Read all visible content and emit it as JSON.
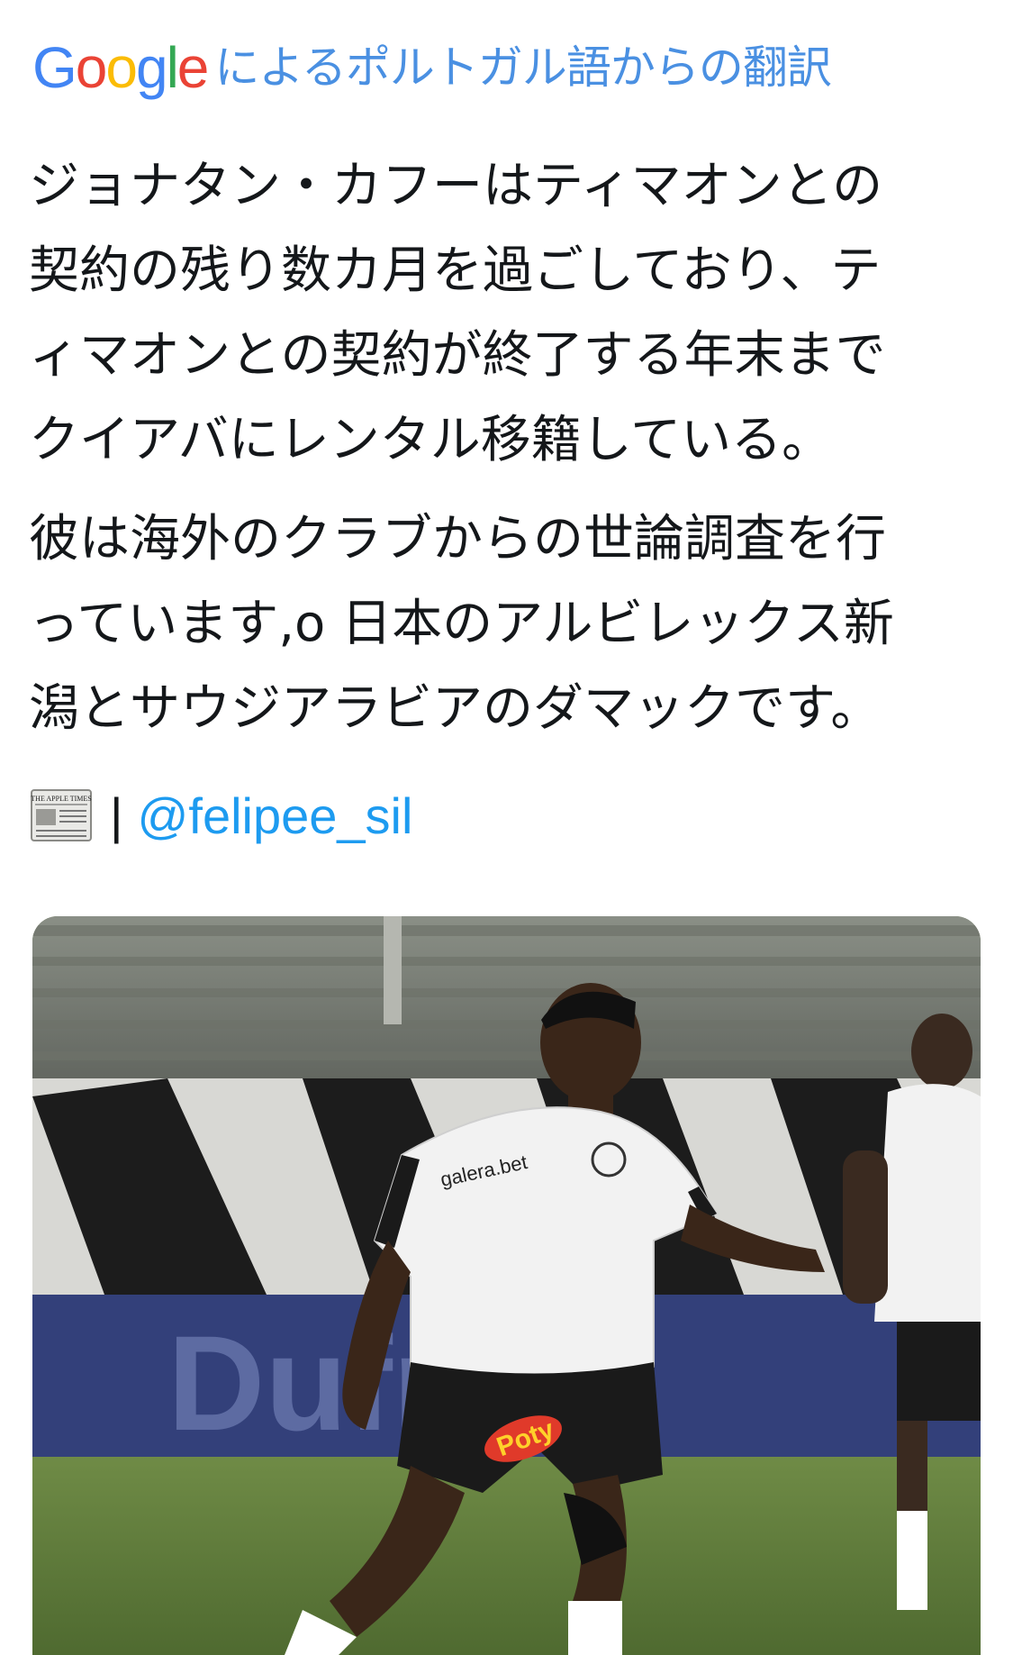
{
  "translation_header": {
    "logo_letters": [
      {
        "char": "G",
        "color": "#4285F4"
      },
      {
        "char": "o",
        "color": "#EA4335"
      },
      {
        "char": "o",
        "color": "#FBBC05"
      },
      {
        "char": "g",
        "color": "#4285F4"
      },
      {
        "char": "l",
        "color": "#34A853"
      },
      {
        "char": "e",
        "color": "#EA4335"
      }
    ],
    "label": "によるポルトガル語からの翻訳"
  },
  "tweet": {
    "paragraphs": [
      "ジョナタン・カフーはティマオンとの\n契約の残り数カ月を過ごしており、テ\nィマオンとの契約が終了する年末まで\nクイアバにレンタル移籍している。",
      "彼は海外のクラブからの世論調査を行\nっています,o 日本のアルビレックス新\n潟とサウジアラビアのダマックです。"
    ]
  },
  "source": {
    "icon": "newspaper-icon",
    "newspaper_masthead": "THE APPLE TIMES",
    "separator": "|",
    "handle": "@felipee_sil"
  },
  "media": {
    "sponsor_banner_text": "Dufrio",
    "jersey_sponsor": "Poty",
    "jersey_sponsor_2": "galera.bet",
    "colors": {
      "pitch": "#5f7a3c",
      "ad_board": "#33407a",
      "kit_shirt": "#f2f2f2",
      "kit_shorts": "#1a1a1a"
    }
  }
}
